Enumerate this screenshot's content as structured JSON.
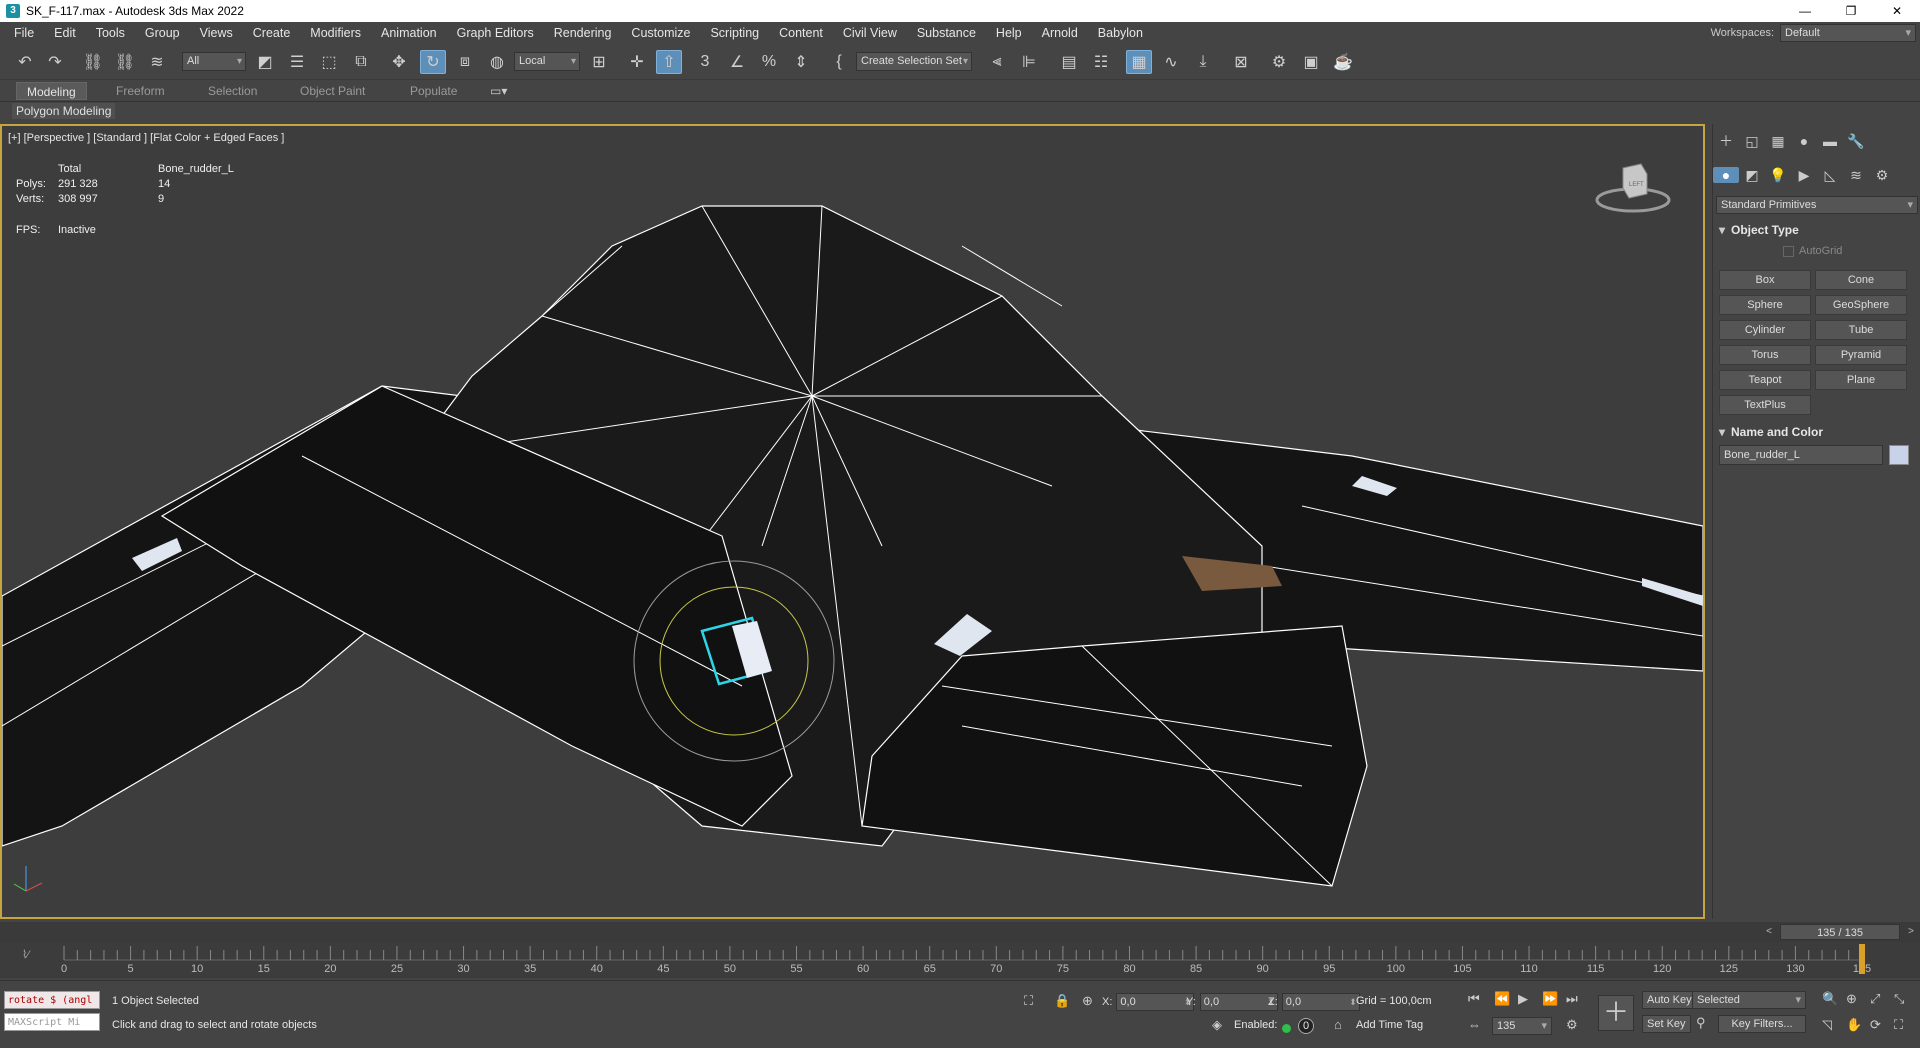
{
  "window": {
    "title": "SK_F-117.max - Autodesk 3ds Max 2022",
    "app_icon": "3",
    "minimize": "—",
    "restore": "❐",
    "close": "✕"
  },
  "menu": [
    "File",
    "Edit",
    "Tools",
    "Group",
    "Views",
    "Create",
    "Modifiers",
    "Animation",
    "Graph Editors",
    "Rendering",
    "Customize",
    "Scripting",
    "Content",
    "Civil View",
    "Substance",
    "Help",
    "Arnold",
    "Babylon"
  ],
  "workspace": {
    "label": "Workspaces:",
    "value": "Default"
  },
  "toolbar": {
    "selection_filter": "All",
    "coord_system": "Local",
    "selection_set": "Create Selection Set",
    "icons": [
      "undo-icon",
      "redo-icon",
      "link-icon",
      "unlink-icon",
      "bind-space-warp-icon",
      "select-object-icon",
      "select-by-name-icon",
      "rectangular-selection-icon",
      "window-crossing-icon",
      "select-move-icon",
      "select-rotate-icon",
      "select-scale-icon",
      "place-icon",
      "pivot-icon",
      "manipulate-icon",
      "keyboard-shortcut-icon",
      "snap-3d-icon",
      "angle-snap-icon",
      "percent-snap-icon",
      "spinner-snap-icon",
      "named-selection-icon",
      "mirror-icon",
      "align-icon",
      "scene-explorer-icon",
      "layer-explorer-icon",
      "toggle-ribbon-icon",
      "curve-editor-icon",
      "schematic-view-icon",
      "material-editor-icon",
      "render-setup-icon",
      "rendered-frame-icon",
      "render-icon",
      "render-cloud-icon"
    ]
  },
  "ribbon": {
    "tabs": [
      "Modeling",
      "Freeform",
      "Selection",
      "Object Paint",
      "Populate"
    ],
    "active": "Modeling",
    "sub_label": "Polygon Modeling"
  },
  "viewport": {
    "label": "[+] [Perspective ] [Standard ] [Flat Color + Edged Faces ]",
    "stats": {
      "col_total": "Total",
      "col_selected": "Bone_rudder_L",
      "polys_label": "Polys:",
      "polys_total": "291 328",
      "polys_selected": "14",
      "verts_label": "Verts:",
      "verts_total": "308 997",
      "verts_selected": "9",
      "fps_label": "FPS:",
      "fps_value": "Inactive"
    },
    "viewcube_label": "LEFT"
  },
  "command_panel": {
    "category": "Standard Primitives",
    "object_type_title": "Object Type",
    "autogrid": "AutoGrid",
    "primitives": [
      "Box",
      "Cone",
      "Sphere",
      "GeoSphere",
      "Cylinder",
      "Tube",
      "Torus",
      "Pyramid",
      "Teapot",
      "Plane",
      "TextPlus"
    ],
    "name_color_title": "Name and Color",
    "object_name": "Bone_rudder_L",
    "object_color": "#c8d3ea"
  },
  "time_slider": {
    "value": "135 / 135",
    "prev": "<",
    "next": ">"
  },
  "trackbar": {
    "labels": [
      "0",
      "5",
      "10",
      "15",
      "20",
      "25",
      "30",
      "35",
      "40",
      "45",
      "50",
      "55",
      "60",
      "65",
      "70",
      "75",
      "80",
      "85",
      "90",
      "95",
      "100",
      "105",
      "110",
      "115",
      "120",
      "125",
      "130",
      "135"
    ],
    "current_frame": 135,
    "max_frame": 135
  },
  "status": {
    "maxscript_line": "rotate $ (angl",
    "maxscript_placeholder": "MAXScript Mi",
    "selected": "1 Object Selected",
    "prompt": "Click and drag to select and rotate objects",
    "x_label": "X:",
    "x_value": "0,0",
    "y_label": "Y:",
    "y_value": "0,0",
    "z_label": "Z:",
    "z_value": "0,0",
    "grid": "Grid = 100,0cm",
    "enabled_label": "Enabled:",
    "enabled_value": "0",
    "add_time_tag": "Add Time Tag",
    "auto_key": "Auto Key",
    "set_key": "Set Key",
    "key_mode": "Selected",
    "key_filters": "Key Filters...",
    "frame_value": "135"
  }
}
